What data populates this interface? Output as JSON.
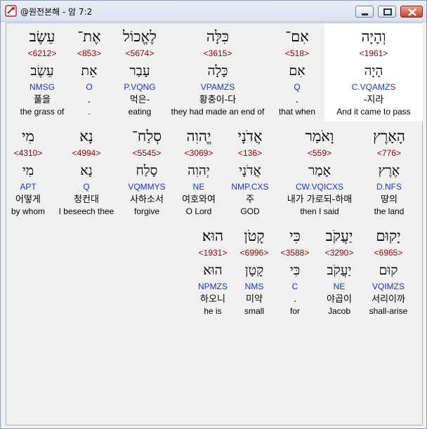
{
  "window": {
    "title": "@원전본해 - 암 7:2"
  },
  "colors": {
    "strong": "#8b0000",
    "morph": "#1a35c0",
    "highlight_bg": "#ffffff",
    "background": "#f0f0f0"
  },
  "rows": [
    {
      "words": [
        {
          "hebrew": "וְהָיָה",
          "strong": "<1961>",
          "lemma": "הָיָה",
          "morph": "C.VQAMZS",
          "korean": "-지라",
          "english": "And it came to pass"
        },
        {
          "hebrew": "אִם־",
          "strong": "<518>",
          "lemma": "אִם",
          "morph": "Q",
          "korean": ".",
          "english": "that when"
        },
        {
          "hebrew": "כִּלָּה",
          "strong": "<3615>",
          "lemma": "כָּלָה",
          "morph": "VPAMZS",
          "korean": "황충이-다",
          "english": "they had made an end of"
        },
        {
          "hebrew": "לֶאֱכוֹל",
          "strong": "<5674>",
          "lemma": "עָבַר",
          "morph": "P.VQNG",
          "korean": "먹은-",
          "english": "eating"
        },
        {
          "hebrew": "אֶת־",
          "strong": "<853>",
          "lemma": "אֵת",
          "morph": "O",
          "korean": ".",
          "english": "."
        },
        {
          "hebrew": "עֵשֶׂב",
          "strong": "<6212>",
          "lemma": "עֵשֶׂב",
          "morph": "NMSG",
          "korean": "풀을",
          "english": "the grass of"
        }
      ]
    },
    {
      "words": [
        {
          "hebrew": "הָאָרֶץ",
          "strong": "<776>",
          "lemma": "אֶרֶץ",
          "morph": "D.NFS",
          "korean": "땅의",
          "english": "the land"
        },
        {
          "hebrew": "וָאֹמַר",
          "strong": "<559>",
          "lemma": "אָמַר",
          "morph": "CW.VQICXS",
          "korean": "내가 가로되-하매",
          "english": "then I said"
        },
        {
          "hebrew": "אֲדֹנָי",
          "strong": "<136>",
          "lemma": "אֲדֹנָי",
          "morph": "NMP.CXS",
          "korean": "주",
          "english": "GOD"
        },
        {
          "hebrew": "יֱהוִה",
          "strong": "<3069>",
          "lemma": "יְהוִה",
          "morph": "NE",
          "korean": "여호와여",
          "english": "O Lord"
        },
        {
          "hebrew": "סְלַח־",
          "strong": "<5545>",
          "lemma": "סָלַח",
          "morph": "VQMMYS",
          "korean": "사하소서",
          "english": "forgive"
        },
        {
          "hebrew": "נָא",
          "strong": "<4994>",
          "lemma": "נָא",
          "morph": "Q",
          "korean": "청컨대",
          "english": "I beseech thee"
        },
        {
          "hebrew": "מִי",
          "strong": "<4310>",
          "lemma": "מִי",
          "morph": "APT",
          "korean": "어떻게",
          "english": "by whom"
        }
      ]
    },
    {
      "words": [
        {
          "hebrew": "יָקוּם",
          "strong": "<6965>",
          "lemma": "קוּם",
          "morph": "VQIMZS",
          "korean": "서리이까",
          "english": "shall-arise"
        },
        {
          "hebrew": "יַעֲקֹב",
          "strong": "<3290>",
          "lemma": "יַעֲקֹב",
          "morph": "NE",
          "korean": "야곱이",
          "english": "Jacob"
        },
        {
          "hebrew": "כִּי",
          "strong": "<3588>",
          "lemma": "כִּי",
          "morph": "C",
          "korean": ".",
          "english": "for"
        },
        {
          "hebrew": "קָטֹן",
          "strong": "<6996>",
          "lemma": "קָטָן",
          "morph": "NMS",
          "korean": "미약",
          "english": "small"
        },
        {
          "hebrew": "הוּא׃",
          "strong": "<1931>",
          "lemma": "הוּא",
          "morph": "NPMZS",
          "korean": "하오니",
          "english": "he is"
        }
      ]
    }
  ]
}
